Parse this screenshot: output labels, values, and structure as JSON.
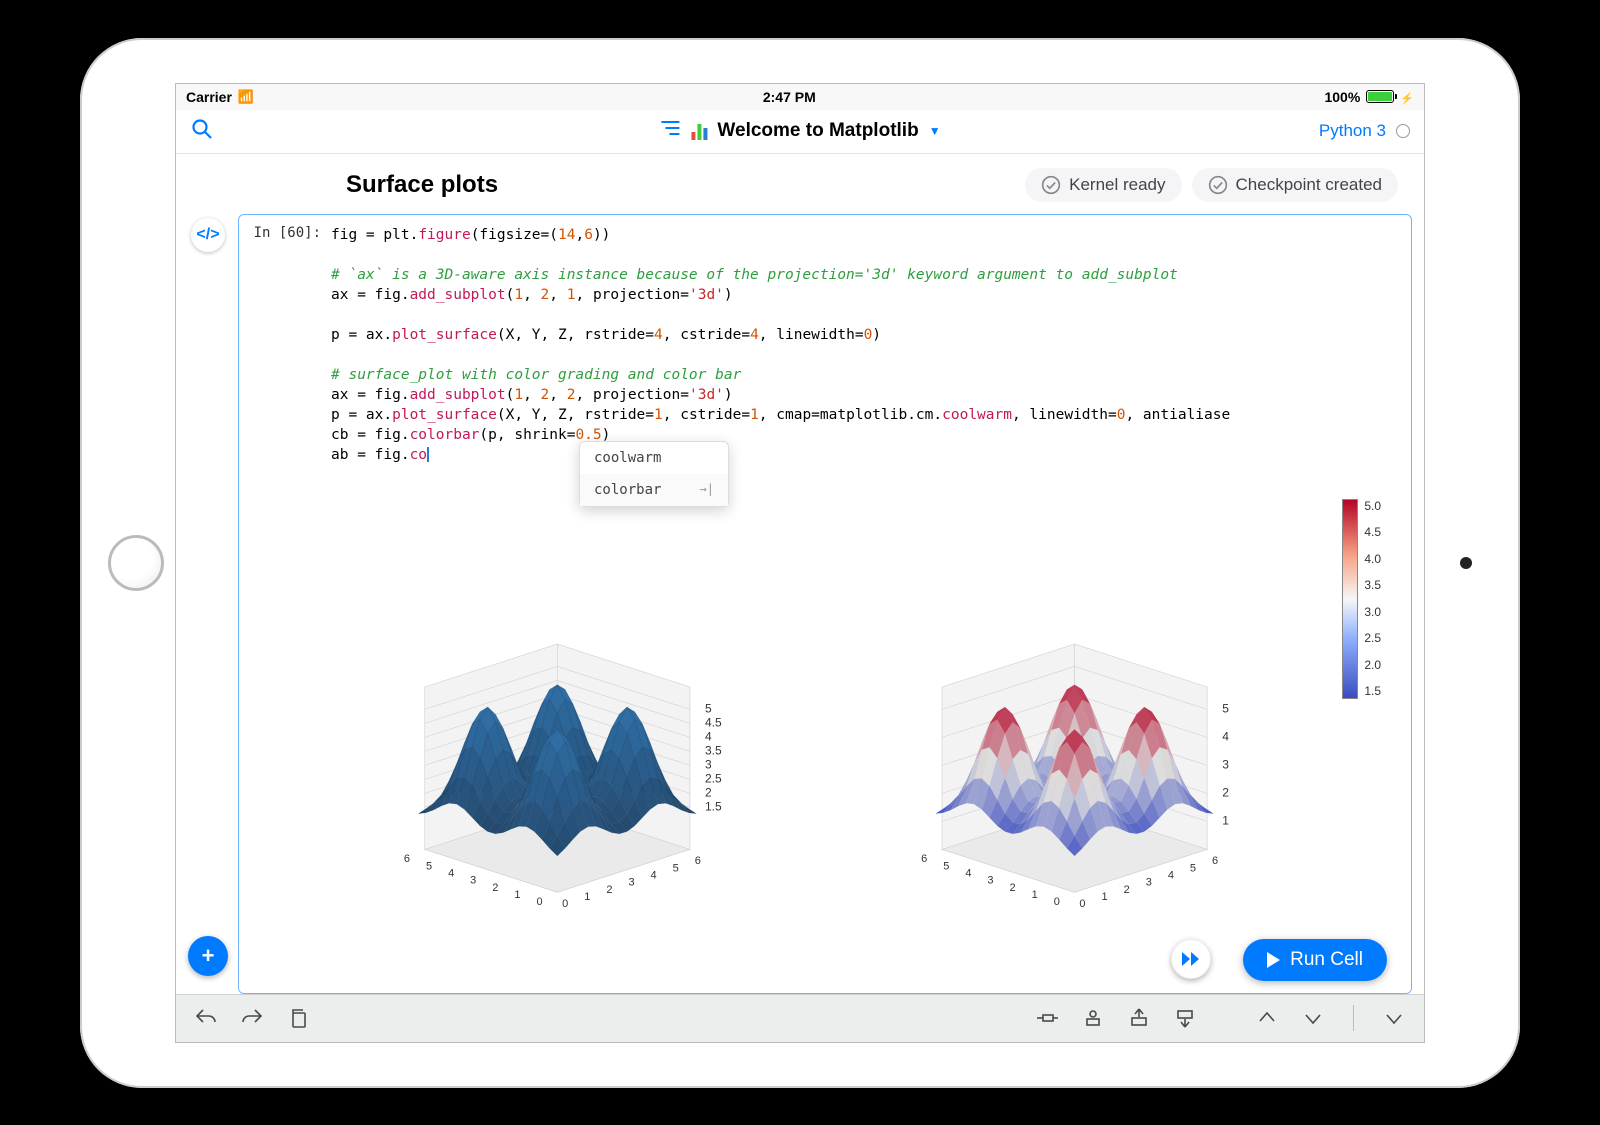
{
  "status_bar": {
    "carrier": "Carrier",
    "time": "2:47 PM",
    "battery_pct": "100%"
  },
  "title_bar": {
    "doc_title": "Welcome to Matplotlib",
    "kernel_name": "Python 3"
  },
  "section": {
    "title": "Surface plots"
  },
  "status_pills": {
    "kernel": "Kernel ready",
    "checkpoint": "Checkpoint created"
  },
  "cell": {
    "prompt": "In [60]:",
    "code_lines": [
      {
        "type": "code",
        "parts": [
          {
            "t": "fig = plt."
          },
          {
            "t": "figure",
            "c": "tok-attr"
          },
          {
            "t": "(figsize=("
          },
          {
            "t": "14",
            "c": "tok-num"
          },
          {
            "t": ","
          },
          {
            "t": "6",
            "c": "tok-num"
          },
          {
            "t": "))"
          }
        ]
      },
      {
        "type": "blank"
      },
      {
        "type": "comment",
        "text": "# `ax` is a 3D-aware axis instance because of the projection='3d' keyword argument to add_subplot"
      },
      {
        "type": "code",
        "parts": [
          {
            "t": "ax = fig."
          },
          {
            "t": "add_subplot",
            "c": "tok-attr"
          },
          {
            "t": "("
          },
          {
            "t": "1",
            "c": "tok-num"
          },
          {
            "t": ", "
          },
          {
            "t": "2",
            "c": "tok-num"
          },
          {
            "t": ", "
          },
          {
            "t": "1",
            "c": "tok-num"
          },
          {
            "t": ", projection="
          },
          {
            "t": "'3d'",
            "c": "tok-str"
          },
          {
            "t": ")"
          }
        ]
      },
      {
        "type": "blank"
      },
      {
        "type": "code",
        "parts": [
          {
            "t": "p = ax."
          },
          {
            "t": "plot_surface",
            "c": "tok-attr"
          },
          {
            "t": "(X, Y, Z, rstride="
          },
          {
            "t": "4",
            "c": "tok-num"
          },
          {
            "t": ", cstride="
          },
          {
            "t": "4",
            "c": "tok-num"
          },
          {
            "t": ", linewidth="
          },
          {
            "t": "0",
            "c": "tok-num"
          },
          {
            "t": ")"
          }
        ]
      },
      {
        "type": "blank"
      },
      {
        "type": "comment",
        "text": "# surface_plot with color grading and color bar"
      },
      {
        "type": "code",
        "parts": [
          {
            "t": "ax = fig."
          },
          {
            "t": "add_subplot",
            "c": "tok-attr"
          },
          {
            "t": "("
          },
          {
            "t": "1",
            "c": "tok-num"
          },
          {
            "t": ", "
          },
          {
            "t": "2",
            "c": "tok-num"
          },
          {
            "t": ", "
          },
          {
            "t": "2",
            "c": "tok-num"
          },
          {
            "t": ", projection="
          },
          {
            "t": "'3d'",
            "c": "tok-str"
          },
          {
            "t": ")"
          }
        ]
      },
      {
        "type": "code",
        "parts": [
          {
            "t": "p = ax."
          },
          {
            "t": "plot_surface",
            "c": "tok-attr"
          },
          {
            "t": "(X, Y, Z, rstride="
          },
          {
            "t": "1",
            "c": "tok-num"
          },
          {
            "t": ", cstride="
          },
          {
            "t": "1",
            "c": "tok-num"
          },
          {
            "t": ", cmap=matplotlib.cm."
          },
          {
            "t": "coolwarm",
            "c": "tok-attr"
          },
          {
            "t": ", linewidth="
          },
          {
            "t": "0",
            "c": "tok-num"
          },
          {
            "t": ", antialiase"
          }
        ]
      },
      {
        "type": "code",
        "parts": [
          {
            "t": "cb = fig."
          },
          {
            "t": "colorbar",
            "c": "tok-attr"
          },
          {
            "t": "(p, shrink="
          },
          {
            "t": "0.5",
            "c": "tok-num"
          },
          {
            "t": ")"
          }
        ]
      },
      {
        "type": "code",
        "parts": [
          {
            "t": "ab = fig."
          },
          {
            "t": "co",
            "c": "tok-attr"
          },
          {
            "t": "",
            "cursor": true
          }
        ]
      }
    ]
  },
  "autocomplete": {
    "items": [
      "coolwarm",
      "colorbar"
    ]
  },
  "run_button": "Run Cell",
  "chart_data": [
    {
      "type": "surface3d",
      "title": "",
      "x_range": [
        0,
        6
      ],
      "y_range": [
        0,
        6
      ],
      "z_range": [
        1.0,
        5.5
      ],
      "x_ticks": [
        0,
        1,
        2,
        3,
        4,
        5,
        6
      ],
      "y_ticks": [
        0,
        1,
        2,
        3,
        4,
        5,
        6
      ],
      "z_ticks": [
        1.5,
        2.0,
        2.5,
        3.0,
        3.5,
        4.0,
        4.5,
        5.0
      ],
      "color": "solid",
      "solid_color": "#2f6f9a",
      "description": "3D surface z=f(x,y) with four peaks ~5.0 and valleys ~1.2, faceted rstride=4",
      "colorbar": false
    },
    {
      "type": "surface3d",
      "title": "",
      "x_range": [
        0,
        6
      ],
      "y_range": [
        0,
        6
      ],
      "z_range": [
        1.0,
        5.5
      ],
      "x_ticks": [
        0,
        1,
        2,
        3,
        4,
        5,
        6
      ],
      "y_ticks": [
        0,
        1,
        2,
        3,
        4,
        5,
        6
      ],
      "z_ticks": [
        1,
        2,
        3,
        4,
        5
      ],
      "color": "coolwarm",
      "description": "Same surface, smooth rstride=1, coolwarm colormap mapped to z",
      "colorbar": true,
      "colorbar_ticks": [
        1.5,
        2.0,
        2.5,
        3.0,
        3.5,
        4.0,
        4.5,
        5.0
      ]
    }
  ]
}
